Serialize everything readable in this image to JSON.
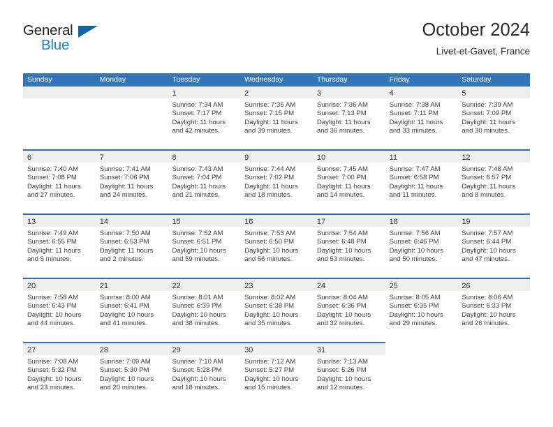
{
  "brand": {
    "name_part1": "General",
    "name_part2": "Blue",
    "triangle_icon": "triangle-icon"
  },
  "header": {
    "title": "October 2024",
    "subtitle": "Livet-et-Gavet, France"
  },
  "calendar": {
    "weekdays": [
      "Sunday",
      "Monday",
      "Tuesday",
      "Wednesday",
      "Thursday",
      "Friday",
      "Saturday"
    ],
    "weeks": [
      [
        {
          "day": "",
          "lines": []
        },
        {
          "day": "",
          "lines": []
        },
        {
          "day": "1",
          "lines": [
            "Sunrise: 7:34 AM",
            "Sunset: 7:17 PM",
            "Daylight: 11 hours",
            "and 42 minutes."
          ]
        },
        {
          "day": "2",
          "lines": [
            "Sunrise: 7:35 AM",
            "Sunset: 7:15 PM",
            "Daylight: 11 hours",
            "and 39 minutes."
          ]
        },
        {
          "day": "3",
          "lines": [
            "Sunrise: 7:36 AM",
            "Sunset: 7:13 PM",
            "Daylight: 11 hours",
            "and 36 minutes."
          ]
        },
        {
          "day": "4",
          "lines": [
            "Sunrise: 7:38 AM",
            "Sunset: 7:11 PM",
            "Daylight: 11 hours",
            "and 33 minutes."
          ]
        },
        {
          "day": "5",
          "lines": [
            "Sunrise: 7:39 AM",
            "Sunset: 7:09 PM",
            "Daylight: 11 hours",
            "and 30 minutes."
          ]
        }
      ],
      [
        {
          "day": "6",
          "lines": [
            "Sunrise: 7:40 AM",
            "Sunset: 7:08 PM",
            "Daylight: 11 hours",
            "and 27 minutes."
          ]
        },
        {
          "day": "7",
          "lines": [
            "Sunrise: 7:41 AM",
            "Sunset: 7:06 PM",
            "Daylight: 11 hours",
            "and 24 minutes."
          ]
        },
        {
          "day": "8",
          "lines": [
            "Sunrise: 7:43 AM",
            "Sunset: 7:04 PM",
            "Daylight: 11 hours",
            "and 21 minutes."
          ]
        },
        {
          "day": "9",
          "lines": [
            "Sunrise: 7:44 AM",
            "Sunset: 7:02 PM",
            "Daylight: 11 hours",
            "and 18 minutes."
          ]
        },
        {
          "day": "10",
          "lines": [
            "Sunrise: 7:45 AM",
            "Sunset: 7:00 PM",
            "Daylight: 11 hours",
            "and 14 minutes."
          ]
        },
        {
          "day": "11",
          "lines": [
            "Sunrise: 7:47 AM",
            "Sunset: 6:58 PM",
            "Daylight: 11 hours",
            "and 11 minutes."
          ]
        },
        {
          "day": "12",
          "lines": [
            "Sunrise: 7:48 AM",
            "Sunset: 6:57 PM",
            "Daylight: 11 hours",
            "and 8 minutes."
          ]
        }
      ],
      [
        {
          "day": "13",
          "lines": [
            "Sunrise: 7:49 AM",
            "Sunset: 6:55 PM",
            "Daylight: 11 hours",
            "and 5 minutes."
          ]
        },
        {
          "day": "14",
          "lines": [
            "Sunrise: 7:50 AM",
            "Sunset: 6:53 PM",
            "Daylight: 11 hours",
            "and 2 minutes."
          ]
        },
        {
          "day": "15",
          "lines": [
            "Sunrise: 7:52 AM",
            "Sunset: 6:51 PM",
            "Daylight: 10 hours",
            "and 59 minutes."
          ]
        },
        {
          "day": "16",
          "lines": [
            "Sunrise: 7:53 AM",
            "Sunset: 6:50 PM",
            "Daylight: 10 hours",
            "and 56 minutes."
          ]
        },
        {
          "day": "17",
          "lines": [
            "Sunrise: 7:54 AM",
            "Sunset: 6:48 PM",
            "Daylight: 10 hours",
            "and 53 minutes."
          ]
        },
        {
          "day": "18",
          "lines": [
            "Sunrise: 7:56 AM",
            "Sunset: 6:46 PM",
            "Daylight: 10 hours",
            "and 50 minutes."
          ]
        },
        {
          "day": "19",
          "lines": [
            "Sunrise: 7:57 AM",
            "Sunset: 6:44 PM",
            "Daylight: 10 hours",
            "and 47 minutes."
          ]
        }
      ],
      [
        {
          "day": "20",
          "lines": [
            "Sunrise: 7:58 AM",
            "Sunset: 6:43 PM",
            "Daylight: 10 hours",
            "and 44 minutes."
          ]
        },
        {
          "day": "21",
          "lines": [
            "Sunrise: 8:00 AM",
            "Sunset: 6:41 PM",
            "Daylight: 10 hours",
            "and 41 minutes."
          ]
        },
        {
          "day": "22",
          "lines": [
            "Sunrise: 8:01 AM",
            "Sunset: 6:39 PM",
            "Daylight: 10 hours",
            "and 38 minutes."
          ]
        },
        {
          "day": "23",
          "lines": [
            "Sunrise: 8:02 AM",
            "Sunset: 6:38 PM",
            "Daylight: 10 hours",
            "and 35 minutes."
          ]
        },
        {
          "day": "24",
          "lines": [
            "Sunrise: 8:04 AM",
            "Sunset: 6:36 PM",
            "Daylight: 10 hours",
            "and 32 minutes."
          ]
        },
        {
          "day": "25",
          "lines": [
            "Sunrise: 8:05 AM",
            "Sunset: 6:35 PM",
            "Daylight: 10 hours",
            "and 29 minutes."
          ]
        },
        {
          "day": "26",
          "lines": [
            "Sunrise: 8:06 AM",
            "Sunset: 6:33 PM",
            "Daylight: 10 hours",
            "and 26 minutes."
          ]
        }
      ],
      [
        {
          "day": "27",
          "lines": [
            "Sunrise: 7:08 AM",
            "Sunset: 5:32 PM",
            "Daylight: 10 hours",
            "and 23 minutes."
          ]
        },
        {
          "day": "28",
          "lines": [
            "Sunrise: 7:09 AM",
            "Sunset: 5:30 PM",
            "Daylight: 10 hours",
            "and 20 minutes."
          ]
        },
        {
          "day": "29",
          "lines": [
            "Sunrise: 7:10 AM",
            "Sunset: 5:28 PM",
            "Daylight: 10 hours",
            "and 18 minutes."
          ]
        },
        {
          "day": "30",
          "lines": [
            "Sunrise: 7:12 AM",
            "Sunset: 5:27 PM",
            "Daylight: 10 hours",
            "and 15 minutes."
          ]
        },
        {
          "day": "31",
          "lines": [
            "Sunrise: 7:13 AM",
            "Sunset: 5:26 PM",
            "Daylight: 10 hours",
            "and 12 minutes."
          ]
        },
        {
          "day": "",
          "lines": []
        },
        {
          "day": "",
          "lines": []
        }
      ]
    ]
  },
  "colors": {
    "header_blue": "#3576b8",
    "row_divider_blue": "#2f6dae",
    "daynum_band": "#efefef",
    "brand_blue": "#1f7fc4",
    "triangle_blue": "#1464a5"
  }
}
